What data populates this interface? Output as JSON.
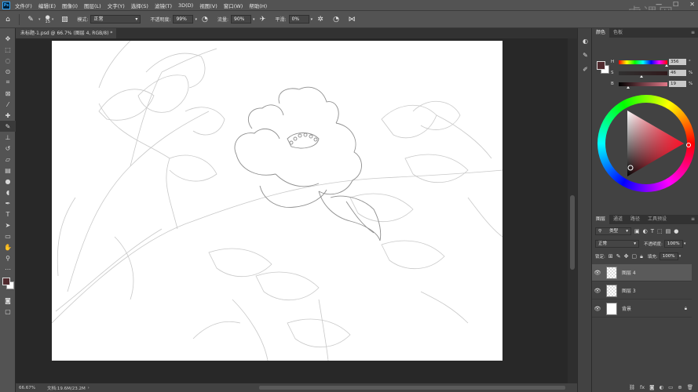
{
  "menubar": {
    "logo": "Ps",
    "items": [
      "文件(F)",
      "编辑(E)",
      "图像(I)",
      "图层(L)",
      "文字(Y)",
      "选择(S)",
      "滤镜(T)",
      "3D(D)",
      "视图(V)",
      "窗口(W)",
      "帮助(H)"
    ],
    "watermark": "虎课网",
    "min": "—",
    "max": "☐",
    "close": "✕"
  },
  "options": {
    "brush_size": "15",
    "mode_label": "模式:",
    "mode_value": "正常",
    "opacity_label": "不透明度:",
    "opacity_value": "99%",
    "flow_label": "流量:",
    "flow_value": "90%",
    "smooth_label": "平滑:",
    "smooth_value": "0%"
  },
  "document": {
    "tab_title": "未标题-1.psd @ 66.7% (图层 4, RGB/8) *",
    "close": "×"
  },
  "status": {
    "zoom": "66.67%",
    "doc": "文档:19.6M/23.2M"
  },
  "color_panel": {
    "tabs": [
      "颜色",
      "色板"
    ],
    "fg_color": "#502a2e",
    "bg_color": "#ffffff",
    "h_label": "H",
    "h_value": "356",
    "h_unit": "°",
    "s_label": "S",
    "s_value": "46",
    "s_unit": "%",
    "b_label": "B",
    "b_value": "19",
    "b_unit": "%",
    "h_fraction": 0.989,
    "s_fraction": 0.46,
    "b_fraction": 0.19
  },
  "layers_panel": {
    "tabs": [
      "图层",
      "通道",
      "路径",
      "工具预设"
    ],
    "filter_kind": "类型",
    "blend_mode": "正常",
    "opacity_label": "不透明度:",
    "opacity_value": "100%",
    "lock_label": "锁定:",
    "fill_label": "填充:",
    "fill_value": "100%",
    "layers": [
      {
        "name": "图层 4",
        "selected": true
      },
      {
        "name": "图层 3",
        "selected": false
      },
      {
        "name": "背景",
        "selected": false
      }
    ]
  }
}
